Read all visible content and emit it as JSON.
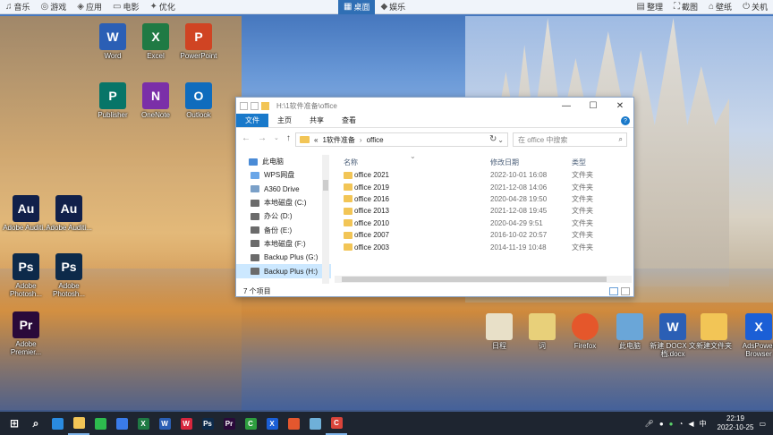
{
  "topbar": {
    "left_items": [
      {
        "icon": "music-note-icon",
        "label": "音乐"
      },
      {
        "icon": "gamepad-icon",
        "label": "游戏"
      },
      {
        "icon": "apps-icon",
        "label": "应用"
      },
      {
        "icon": "tv-icon",
        "label": "电影"
      },
      {
        "icon": "lightning-icon",
        "label": "优化"
      }
    ],
    "center_tabs": [
      {
        "icon": "desktop-icon",
        "label": "桌面",
        "active": true
      },
      {
        "icon": "entertainment-icon",
        "label": "娱乐",
        "active": false
      }
    ],
    "right_items": [
      {
        "icon": "organize-icon",
        "label": "整理"
      },
      {
        "icon": "screenshot-icon",
        "label": "截图"
      },
      {
        "icon": "skin-icon",
        "label": "壁纸"
      },
      {
        "icon": "power-icon",
        "label": "关机"
      }
    ]
  },
  "desktop_icons": [
    {
      "name": "word",
      "label": "Word",
      "abbr": "W",
      "color": "#2b5fb5"
    },
    {
      "name": "excel",
      "label": "Excel",
      "abbr": "X",
      "color": "#1f7a44"
    },
    {
      "name": "powerpoint",
      "label": "PowerPoint",
      "abbr": "P",
      "color": "#d04423"
    },
    {
      "name": "publisher",
      "label": "Publisher",
      "abbr": "P",
      "color": "#077568"
    },
    {
      "name": "onenote",
      "label": "OneNote",
      "abbr": "N",
      "color": "#7b2fa8"
    },
    {
      "name": "outlook",
      "label": "Outlook",
      "abbr": "O",
      "color": "#0f6cbd"
    },
    {
      "name": "audition-1",
      "label": "Adobe Auditi...",
      "abbr": "Au",
      "color": "#11204a"
    },
    {
      "name": "audition-2",
      "label": "Adobe Auditi...",
      "abbr": "Au",
      "color": "#11204a"
    },
    {
      "name": "photoshop-1",
      "label": "Adobe Photosh...",
      "abbr": "Ps",
      "color": "#0d2a4a"
    },
    {
      "name": "photoshop-2",
      "label": "Adobe Photosh...",
      "abbr": "Ps",
      "color": "#0d2a4a"
    },
    {
      "name": "premiere",
      "label": "Adobe Premier...",
      "abbr": "Pr",
      "color": "#2a0a3a"
    },
    {
      "name": "shortcut-1",
      "label": "日程",
      "abbr": "",
      "color": "#e8e0c8"
    },
    {
      "name": "shortcut-2",
      "label": "词",
      "abbr": "",
      "color": "#e8d07a"
    },
    {
      "name": "firefox",
      "label": "Firefox",
      "abbr": "",
      "color": "#e5572b"
    },
    {
      "name": "this-pc",
      "label": "此电脑",
      "abbr": "",
      "color": "#6aa6d8"
    },
    {
      "name": "docx",
      "label": "新建 DOCX 文档.docx",
      "abbr": "W",
      "color": "#2b5fb5"
    },
    {
      "name": "new-folder",
      "label": "新建文件夹",
      "abbr": "",
      "color": "#f2c556"
    },
    {
      "name": "adspower",
      "label": "AdsPower Browser",
      "abbr": "X",
      "color": "#1b5fd6"
    }
  ],
  "explorer": {
    "title_path": "H:\\1软件准备\\office",
    "ribbon_tabs": [
      "文件",
      "主页",
      "共享",
      "查看"
    ],
    "breadcrumb": [
      "«",
      "1软件准备",
      "›",
      "office"
    ],
    "search_placeholder": "在 office 中搜索",
    "nav_items": [
      {
        "label": "此电脑",
        "icon": "pc-icon"
      },
      {
        "label": "WPS网盘",
        "icon": "cloud-icon"
      },
      {
        "label": "A360 Drive",
        "icon": "drive-icon"
      },
      {
        "label": "本地磁盘 (C:)",
        "icon": "disk-icon"
      },
      {
        "label": "办公 (D:)",
        "icon": "disk-icon"
      },
      {
        "label": "备份 (E:)",
        "icon": "disk-icon"
      },
      {
        "label": "本地磁盘 (F:)",
        "icon": "disk-icon"
      },
      {
        "label": "Backup Plus (G:)",
        "icon": "disk-icon"
      },
      {
        "label": "Backup Plus (H:)",
        "icon": "disk-icon",
        "selected": true
      }
    ],
    "columns": {
      "name": "名称",
      "date": "修改日期",
      "type": "类型"
    },
    "files": [
      {
        "name": "office 2021",
        "date": "2022-10-01 16:08",
        "type": "文件夹"
      },
      {
        "name": "office 2019",
        "date": "2021-12-08 14:06",
        "type": "文件夹"
      },
      {
        "name": "office 2016",
        "date": "2020-04-28 19:50",
        "type": "文件夹"
      },
      {
        "name": "office 2013",
        "date": "2021-12-08 19:45",
        "type": "文件夹"
      },
      {
        "name": "office 2010",
        "date": "2020-04-29 9:51",
        "type": "文件夹"
      },
      {
        "name": "office 2007",
        "date": "2016-10-02 20:57",
        "type": "文件夹"
      },
      {
        "name": "office 2003",
        "date": "2014-11-19 10:48",
        "type": "文件夹"
      }
    ],
    "status": "7 个项目"
  },
  "taskbar": {
    "apps": [
      {
        "name": "start",
        "abbr": "⊞",
        "color": "#1e2530"
      },
      {
        "name": "search",
        "abbr": "⌕",
        "color": "#1e2530"
      },
      {
        "name": "browser-360",
        "abbr": "",
        "color": "#2a8be0"
      },
      {
        "name": "file-explorer",
        "abbr": "",
        "color": "#f2c556"
      },
      {
        "name": "wechat-app",
        "abbr": "",
        "color": "#2dbb4e"
      },
      {
        "name": "feishu",
        "abbr": "",
        "color": "#3a7be8"
      },
      {
        "name": "excel",
        "abbr": "X",
        "color": "#1f7a44"
      },
      {
        "name": "word",
        "abbr": "W",
        "color": "#2b5fb5"
      },
      {
        "name": "wps",
        "abbr": "W",
        "color": "#d7263d"
      },
      {
        "name": "photoshop",
        "abbr": "Ps",
        "color": "#0d2a4a"
      },
      {
        "name": "premiere",
        "abbr": "Pr",
        "color": "#2a0a3a"
      },
      {
        "name": "camtasia",
        "abbr": "C",
        "color": "#2d9e3e"
      },
      {
        "name": "adspower",
        "abbr": "X",
        "color": "#1b5fd6"
      },
      {
        "name": "app-orange",
        "abbr": "",
        "color": "#e4572e"
      },
      {
        "name": "app-notes",
        "abbr": "",
        "color": "#6fb0d8"
      },
      {
        "name": "recorder",
        "abbr": "C",
        "color": "#d9443a"
      }
    ],
    "time": "22:19",
    "date": "2022-10-25"
  }
}
